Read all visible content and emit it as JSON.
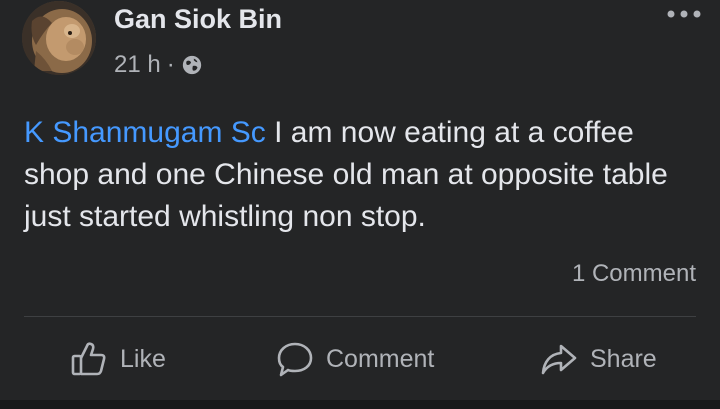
{
  "post": {
    "author": "Gan Siok Bin",
    "timestamp": "21 h",
    "separator": "·",
    "privacy_icon": "globe-icon",
    "mention": "K Shanmugam Sc",
    "body": " I am now eating at a coffee shop and one Chinese old man at opposite table just started whistling non stop.",
    "comment_count": "1 Comment"
  },
  "actions": {
    "like": "Like",
    "comment": "Comment",
    "share": "Share"
  },
  "colors": {
    "background": "#242526",
    "text": "#e4e6eb",
    "secondary_text": "#b0b3b8",
    "mention": "#4599ff",
    "divider": "#3e4042"
  }
}
